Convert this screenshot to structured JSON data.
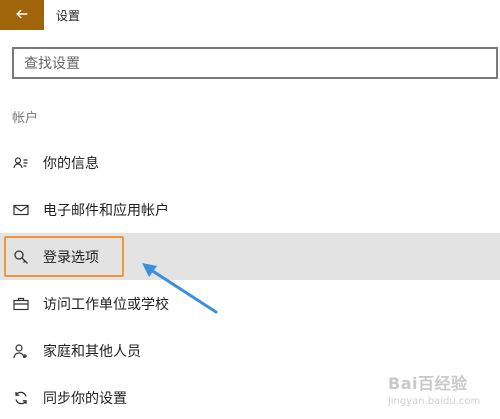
{
  "header": {
    "title": "设置"
  },
  "search": {
    "placeholder": "查找设置"
  },
  "section": {
    "label": "帐户"
  },
  "nav": {
    "items": [
      {
        "label": "你的信息",
        "icon": "person-card-icon"
      },
      {
        "label": "电子邮件和应用帐户",
        "icon": "mail-icon"
      },
      {
        "label": "登录选项",
        "icon": "key-icon",
        "selected": true
      },
      {
        "label": "访问工作单位或学校",
        "icon": "briefcase-icon"
      },
      {
        "label": "家庭和其他人员",
        "icon": "person-add-icon"
      },
      {
        "label": "同步你的设置",
        "icon": "sync-icon"
      }
    ]
  },
  "colors": {
    "accent": "#a0640a",
    "highlight_border": "#f0953c",
    "annotation_arrow": "#3b8fdb",
    "selected_background": "#e3e3e3"
  },
  "watermark": {
    "text": "Bai百经验",
    "sub": "jingyan.baidu.com"
  }
}
